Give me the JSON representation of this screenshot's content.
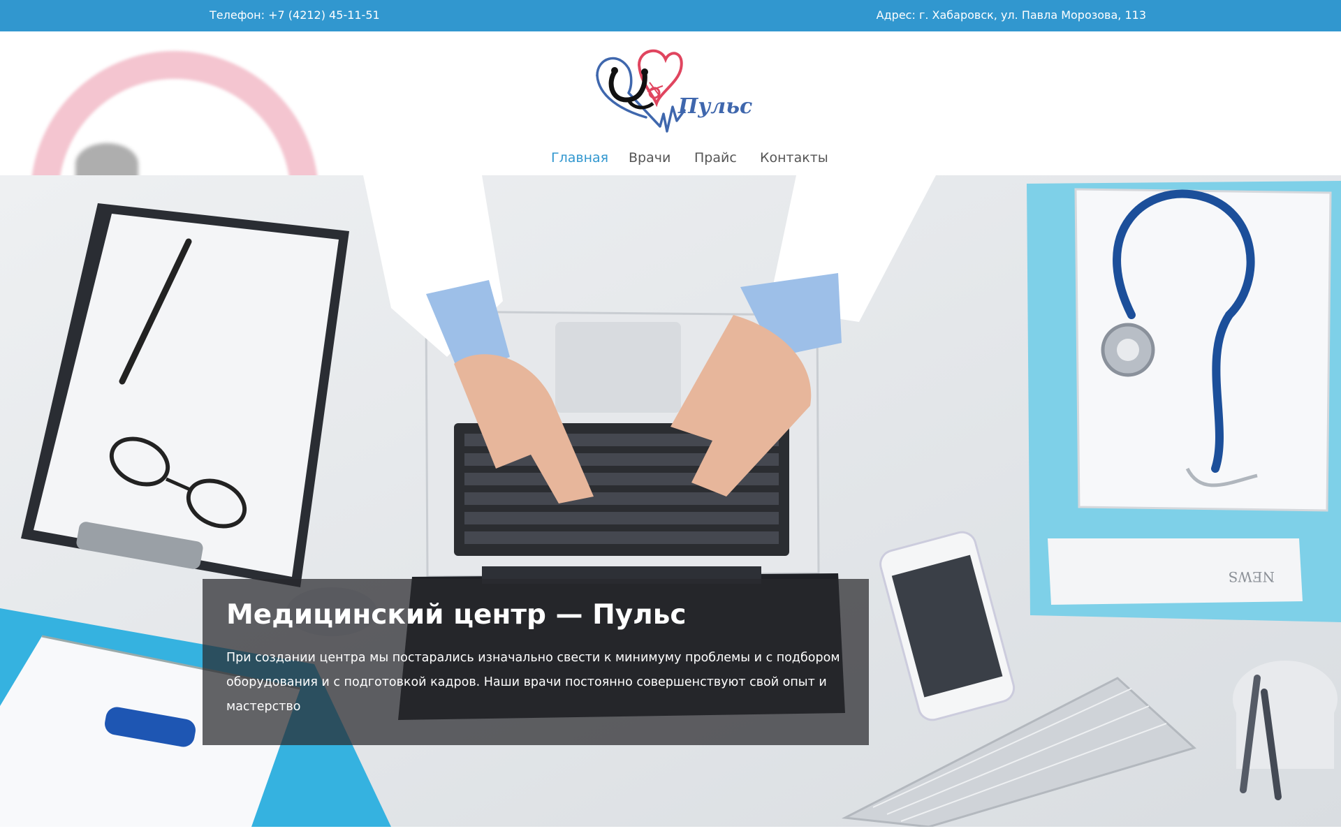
{
  "topbar": {
    "phone": "Телефон: +7 (4212) 45-11-51",
    "address": "Адрес: г. Хабаровск, ул. Павла Морозова, 113"
  },
  "logo": {
    "text": "Пульс",
    "icon": "heart-stethoscope-logo",
    "colors": {
      "red": "#e0455f",
      "blue": "#3f67ad",
      "black": "#111111"
    }
  },
  "nav": {
    "items": [
      {
        "label": "Главная",
        "active": true
      },
      {
        "label": "Врачи",
        "active": false
      },
      {
        "label": "Прайс",
        "active": false
      },
      {
        "label": "Контакты",
        "active": false
      }
    ]
  },
  "hero": {
    "title": "Медицинский центр — Пульс",
    "text": "При создании центра мы постарались изначально свести к минимуму проблемы и с подбором оборудования и с подготовкой кадров. Наши врачи постоянно совершенствуют свой опыт и мастерство",
    "image": "doctor-desk-laptop-photo",
    "desk_note": "NEWS"
  },
  "colors": {
    "accent": "#3197cf",
    "nav_text": "#555555",
    "caption_bg": "rgba(40,40,45,0.72)"
  }
}
